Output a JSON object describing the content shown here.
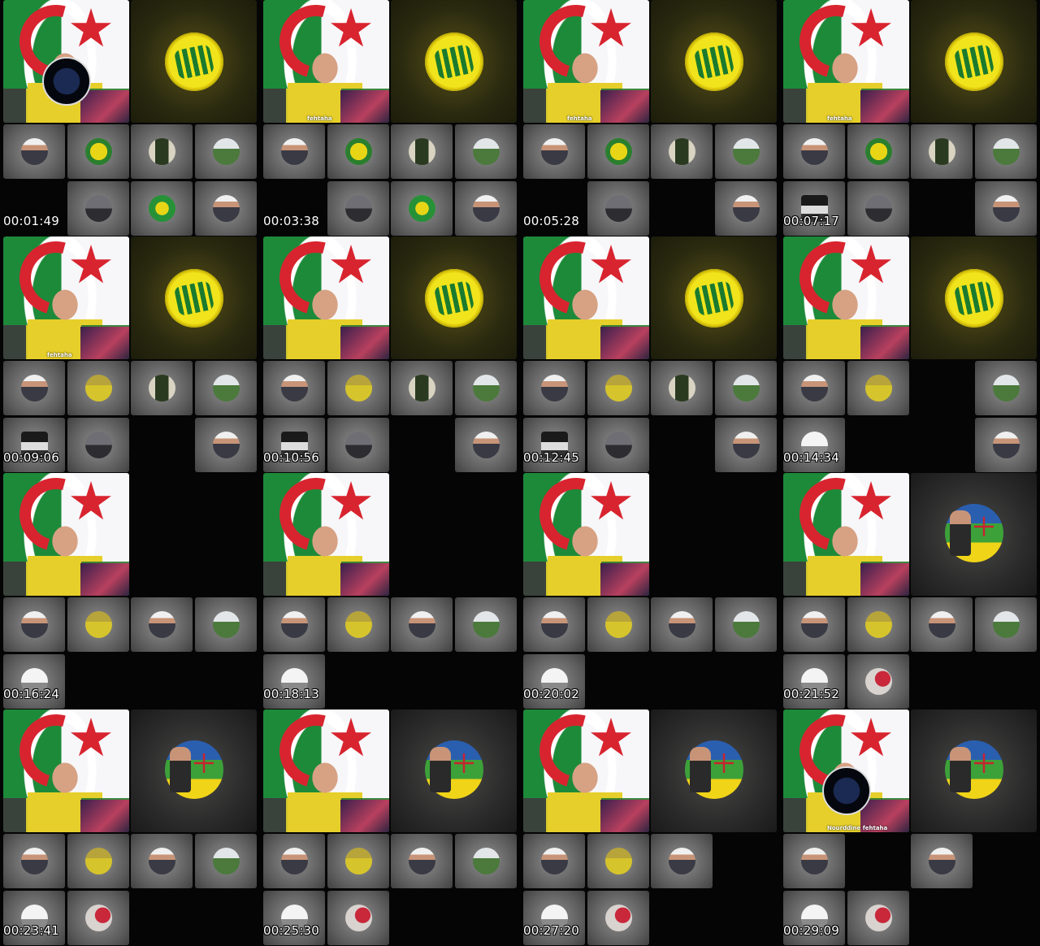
{
  "sheet": {
    "frames": [
      {
        "timestamp": "00:01:49",
        "host_caption": "",
        "host_logo": true,
        "big": "badge",
        "row1": [
          "man",
          "yellowteam",
          "gate",
          "stadium"
        ],
        "row2": [
          "dark",
          "city",
          "greenball",
          "man"
        ]
      },
      {
        "timestamp": "00:03:38",
        "host_caption": "fehtaha",
        "host_logo": false,
        "big": "badge",
        "row1": [
          "man",
          "yellowteam",
          "gate",
          "stadium"
        ],
        "row2": [
          "dark",
          "city",
          "greenball",
          "man"
        ]
      },
      {
        "timestamp": "00:05:28",
        "host_caption": "fehtaha",
        "host_logo": false,
        "big": "badge",
        "row1": [
          "man",
          "yellowteam",
          "gate",
          "stadium"
        ],
        "row2": [
          "dark",
          "city",
          "dark",
          "man"
        ]
      },
      {
        "timestamp": "00:07:17",
        "host_caption": "fehtaha",
        "host_logo": false,
        "big": "badge",
        "row1": [
          "man",
          "yellowteam",
          "gate",
          "stadium"
        ],
        "row2": [
          "bus",
          "city",
          "dark",
          "man"
        ]
      },
      {
        "timestamp": "00:09:06",
        "host_caption": "fehtaha",
        "host_logo": false,
        "big": "badge",
        "row1": [
          "man",
          "yellowfan",
          "gate",
          "stadium"
        ],
        "row2": [
          "bus",
          "city",
          "dark",
          "man"
        ]
      },
      {
        "timestamp": "00:10:56",
        "host_caption": "",
        "host_logo": false,
        "big": "badge",
        "row1": [
          "man",
          "yellowfan",
          "gate",
          "stadium"
        ],
        "row2": [
          "bus",
          "city",
          "dark",
          "man"
        ]
      },
      {
        "timestamp": "00:12:45",
        "host_caption": "",
        "host_logo": false,
        "big": "badge",
        "row1": [
          "man",
          "yellowfan",
          "gate",
          "stadium"
        ],
        "row2": [
          "bus",
          "city",
          "dark",
          "man"
        ]
      },
      {
        "timestamp": "00:14:34",
        "host_caption": "",
        "host_logo": false,
        "big": "badge",
        "row1": [
          "man",
          "yellowfan",
          "dark",
          "stadium"
        ],
        "row2": [
          "card",
          "dark",
          "dark",
          "man"
        ]
      },
      {
        "timestamp": "00:16:24",
        "host_caption": "",
        "host_logo": false,
        "big": "empty",
        "row1": [
          "man",
          "yellowfan",
          "man",
          "stadium"
        ],
        "row2": [
          "card",
          "dark",
          "dark",
          "dark"
        ]
      },
      {
        "timestamp": "00:18:13",
        "host_caption": "",
        "host_logo": false,
        "big": "empty",
        "row1": [
          "man",
          "yellowfan",
          "man",
          "stadium"
        ],
        "row2": [
          "card",
          "dark",
          "dark",
          "dark"
        ]
      },
      {
        "timestamp": "00:20:02",
        "host_caption": "",
        "host_logo": false,
        "big": "empty",
        "row1": [
          "man",
          "yellowfan",
          "man",
          "stadium"
        ],
        "row2": [
          "card",
          "dark",
          "dark",
          "dark"
        ]
      },
      {
        "timestamp": "00:21:52",
        "host_caption": "",
        "host_logo": false,
        "big": "flag",
        "row1": [
          "man",
          "yellowfan",
          "man",
          "stadium"
        ],
        "row2": [
          "card",
          "redobj",
          "dark",
          "dark"
        ]
      },
      {
        "timestamp": "00:23:41",
        "host_caption": "",
        "host_logo": false,
        "big": "flag",
        "row1": [
          "man",
          "yellowfan",
          "man",
          "stadium"
        ],
        "row2": [
          "card",
          "redobj",
          "dark",
          "dark"
        ]
      },
      {
        "timestamp": "00:25:30",
        "host_caption": "",
        "host_logo": false,
        "big": "flag",
        "row1": [
          "man",
          "yellowfan",
          "man",
          "stadium"
        ],
        "row2": [
          "card",
          "redobj",
          "dark",
          "dark"
        ]
      },
      {
        "timestamp": "00:27:20",
        "host_caption": "",
        "host_logo": false,
        "big": "flag",
        "row1": [
          "man",
          "yellowfan",
          "man",
          "dark"
        ],
        "row2": [
          "card",
          "redobj",
          "dark",
          "dark"
        ]
      },
      {
        "timestamp": "00:29:09",
        "host_caption": "Nourddine fehtaha",
        "host_logo": true,
        "big": "flag",
        "row1": [
          "man",
          "dark",
          "man",
          "dark"
        ],
        "row2": [
          "card",
          "redobj",
          "dark",
          "dark"
        ]
      }
    ]
  }
}
